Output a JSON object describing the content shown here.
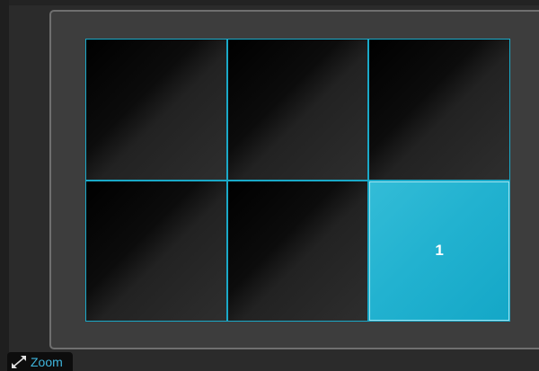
{
  "grid": {
    "cells": [
      {
        "label": "",
        "active": false
      },
      {
        "label": "",
        "active": false
      },
      {
        "label": "",
        "active": false
      },
      {
        "label": "",
        "active": false
      },
      {
        "label": "",
        "active": false
      },
      {
        "label": "1",
        "active": true
      }
    ]
  },
  "zoom": {
    "label": "Zoom",
    "icon": "expand-arrows-icon"
  },
  "colors": {
    "accent": "#1aa9c8",
    "active_cell": "#22b2d0",
    "zoom_text": "#3fb6de"
  }
}
